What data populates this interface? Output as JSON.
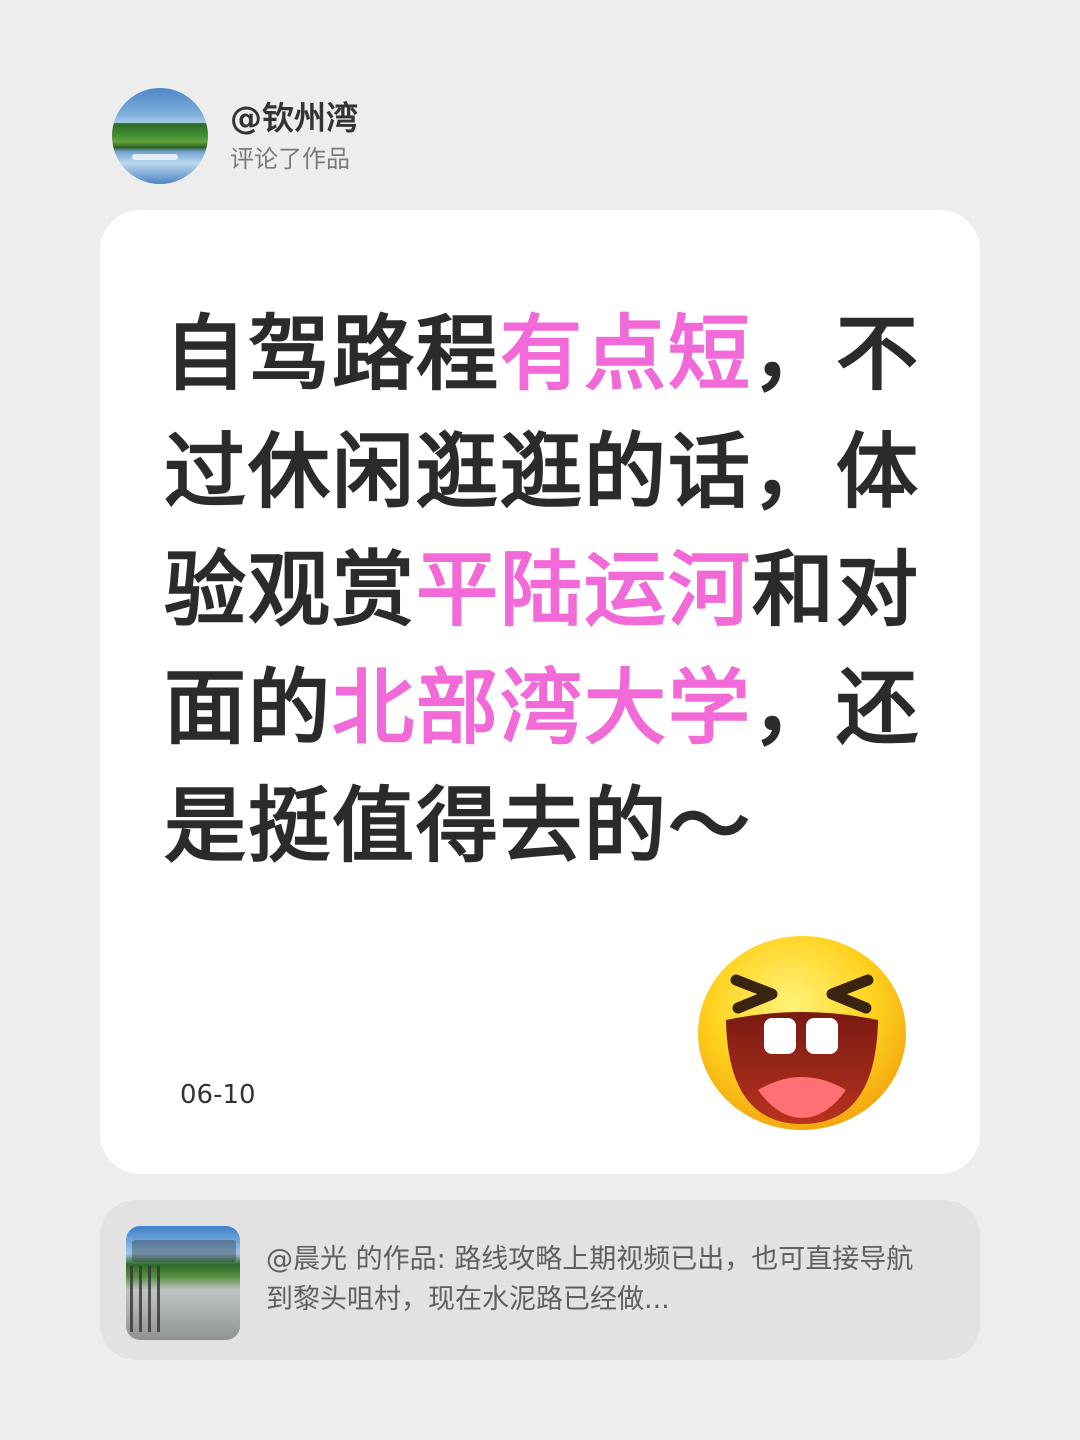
{
  "header": {
    "username": "@钦州湾",
    "action": "评论了作品",
    "avatar_icon": "landscape-avatar"
  },
  "comment": {
    "segments": [
      {
        "text": "自驾路程",
        "highlight": false
      },
      {
        "text": "有点短",
        "highlight": true
      },
      {
        "text": "，不过休闲逛逛的话，体验观赏",
        "highlight": false
      },
      {
        "text": "平陆运河",
        "highlight": true
      },
      {
        "text": "和对面的",
        "highlight": false
      },
      {
        "text": "北部湾大学",
        "highlight": true
      },
      {
        "text": "，还是挺值得去的～",
        "highlight": false
      }
    ],
    "date": "06-10",
    "emoji": "laughing-emoji",
    "highlight_color": "#f26ad7"
  },
  "reference": {
    "text": "@晨光  的作品: 路线攻略上期视频已出，也可直接导航到黎头咀村，现在水泥路已经做...",
    "thumbnail_icon": "video-thumbnail"
  }
}
